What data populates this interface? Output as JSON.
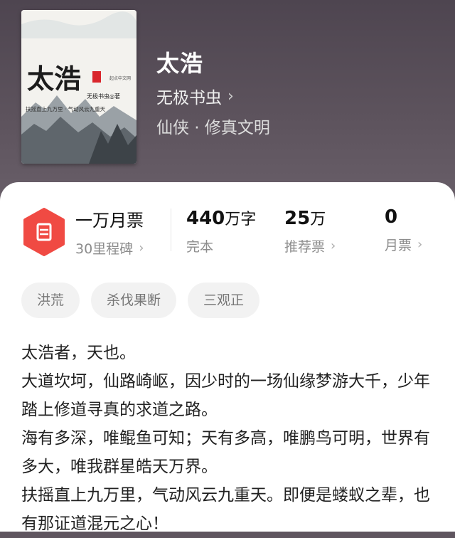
{
  "book": {
    "title": "太浩",
    "author": "无极书虫",
    "genre": "仙侠 · 修真文明"
  },
  "cover": {
    "title": "太浩",
    "author_tag": "无极书虫◎著",
    "tagline": "扶摇直上九万里 · 气动风云九重天",
    "stamp": "起点中文网"
  },
  "stats": {
    "monthly_ticket_badge": {
      "main": "一万月票",
      "sub": "30里程碑"
    },
    "word_count": {
      "number": "440",
      "unit": "万字",
      "sub": "完本"
    },
    "recommend": {
      "number": "25",
      "unit": "万",
      "sub": "推荐票"
    },
    "monthly": {
      "number": "0",
      "unit": "",
      "sub": "月票"
    }
  },
  "tags": [
    "洪荒",
    "杀伐果断",
    "三观正"
  ],
  "description": [
    "太浩者，天也。",
    "大道坎坷，仙路崎岖，因少时的一场仙缘梦游大千，少年踏上修道寻真的求道之路。",
    "海有多深，唯鲲鱼可知；天有多高，唯鹏鸟可明，世界有多大，唯我群星皓天万界。",
    "扶摇直上九万里，气动风云九重天。即便是蝼蚁之辈，也有那证道混元之心！"
  ],
  "colors": {
    "hero_bg": "#5d535d",
    "badge_red": "#f04a43",
    "text_dark": "#222222",
    "text_muted": "#8c8c8c",
    "tag_bg": "#f2f2f2"
  },
  "icons": {
    "badge": "ticket-icon",
    "chevron": "chevron-right-icon"
  }
}
